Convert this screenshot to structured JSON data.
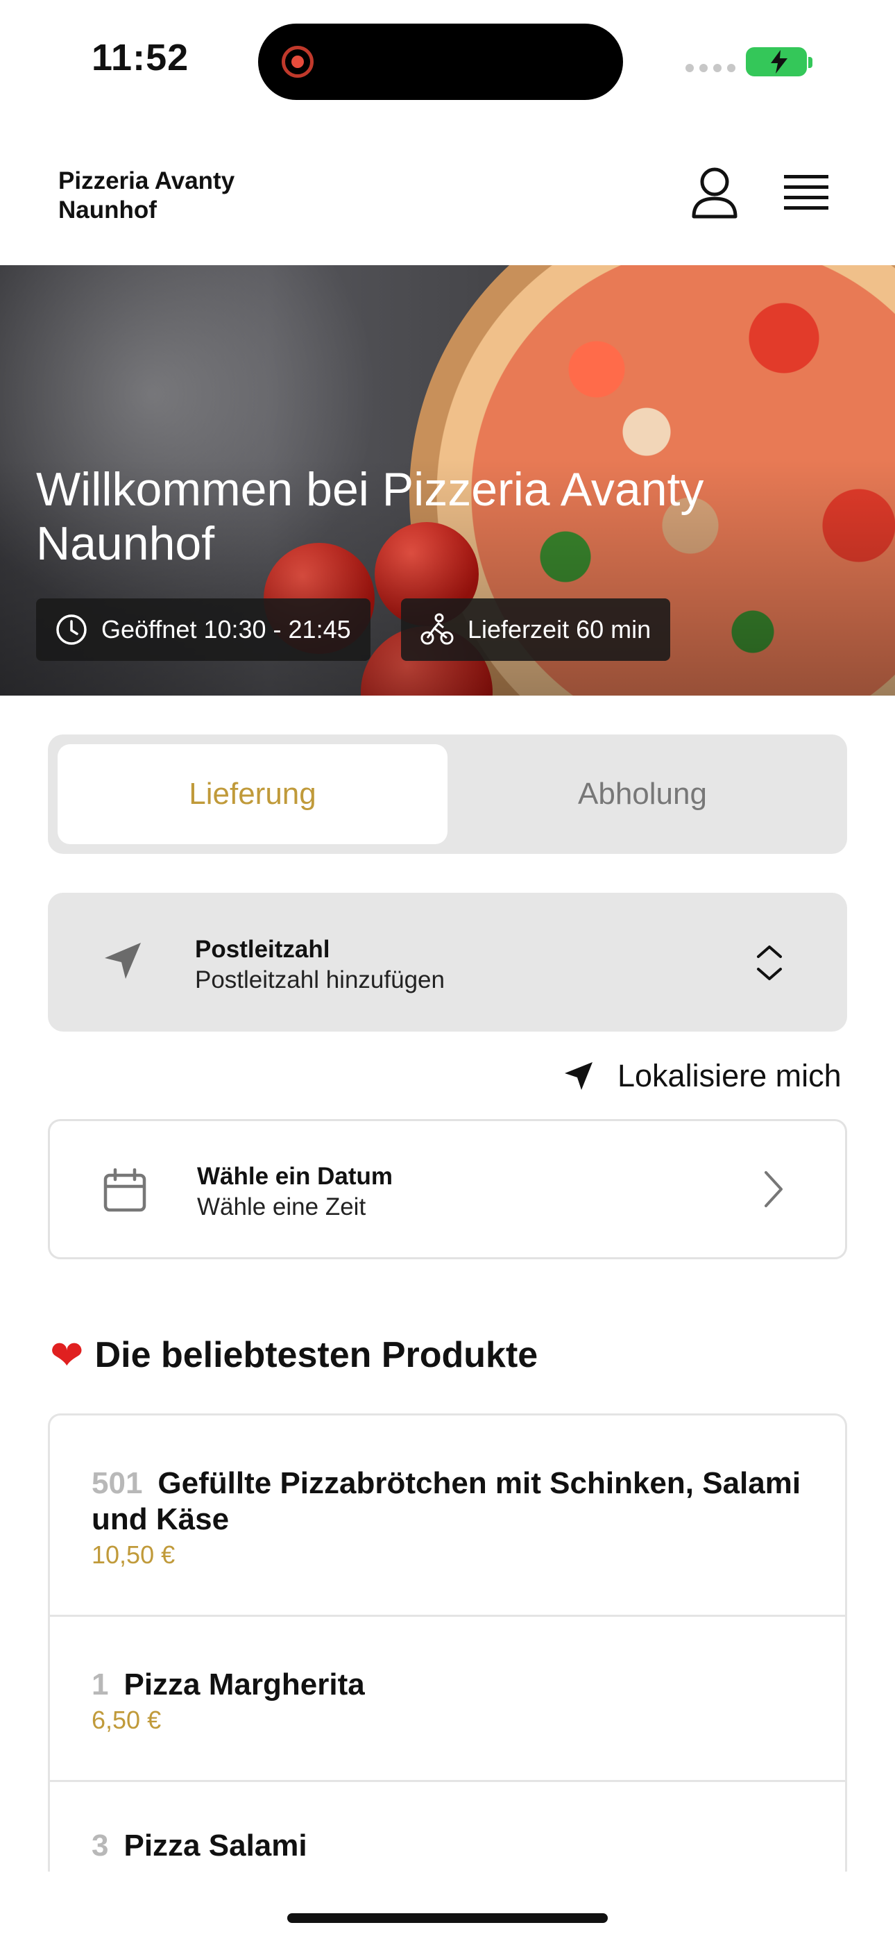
{
  "status_bar": {
    "time": "11:52"
  },
  "header": {
    "brand_line1": "Pizzeria Avanty",
    "brand_line2": "Naunhof"
  },
  "hero": {
    "title": "Willkommen bei Pizzeria Avanty Naunhof",
    "open_hours": "Geöffnet 10:30 - 21:45",
    "delivery_time": "Lieferzeit 60 min"
  },
  "tabs": {
    "delivery": "Lieferung",
    "pickup": "Abholung",
    "active": "delivery"
  },
  "postal": {
    "label": "Postleitzahl",
    "placeholder": "Postleitzahl hinzufügen"
  },
  "locate": {
    "label": "Lokalisiere mich"
  },
  "date": {
    "label": "Wähle ein Datum",
    "sub": "Wähle eine Zeit"
  },
  "products": {
    "title": "Die beliebtesten Produkte",
    "heart_icon": "❤",
    "items": [
      {
        "number": "501",
        "name": "Gefüllte Pizzabrötchen mit Schinken, Salami und Käse",
        "price": "10,50 €"
      },
      {
        "number": "1",
        "name": "Pizza Margherita",
        "price": "6,50 €"
      },
      {
        "number": "3",
        "name": "Pizza Salami",
        "price": ""
      }
    ]
  },
  "colors": {
    "accent": "#c09a3a",
    "panel": "#e6e6e6",
    "battery": "#34c759"
  },
  "icons": [
    "clock-icon",
    "bike-icon",
    "user-icon",
    "menu-icon",
    "location-arrow-icon",
    "chevron-updown-icon",
    "calendar-icon",
    "chevron-right-icon",
    "heart-icon"
  ]
}
